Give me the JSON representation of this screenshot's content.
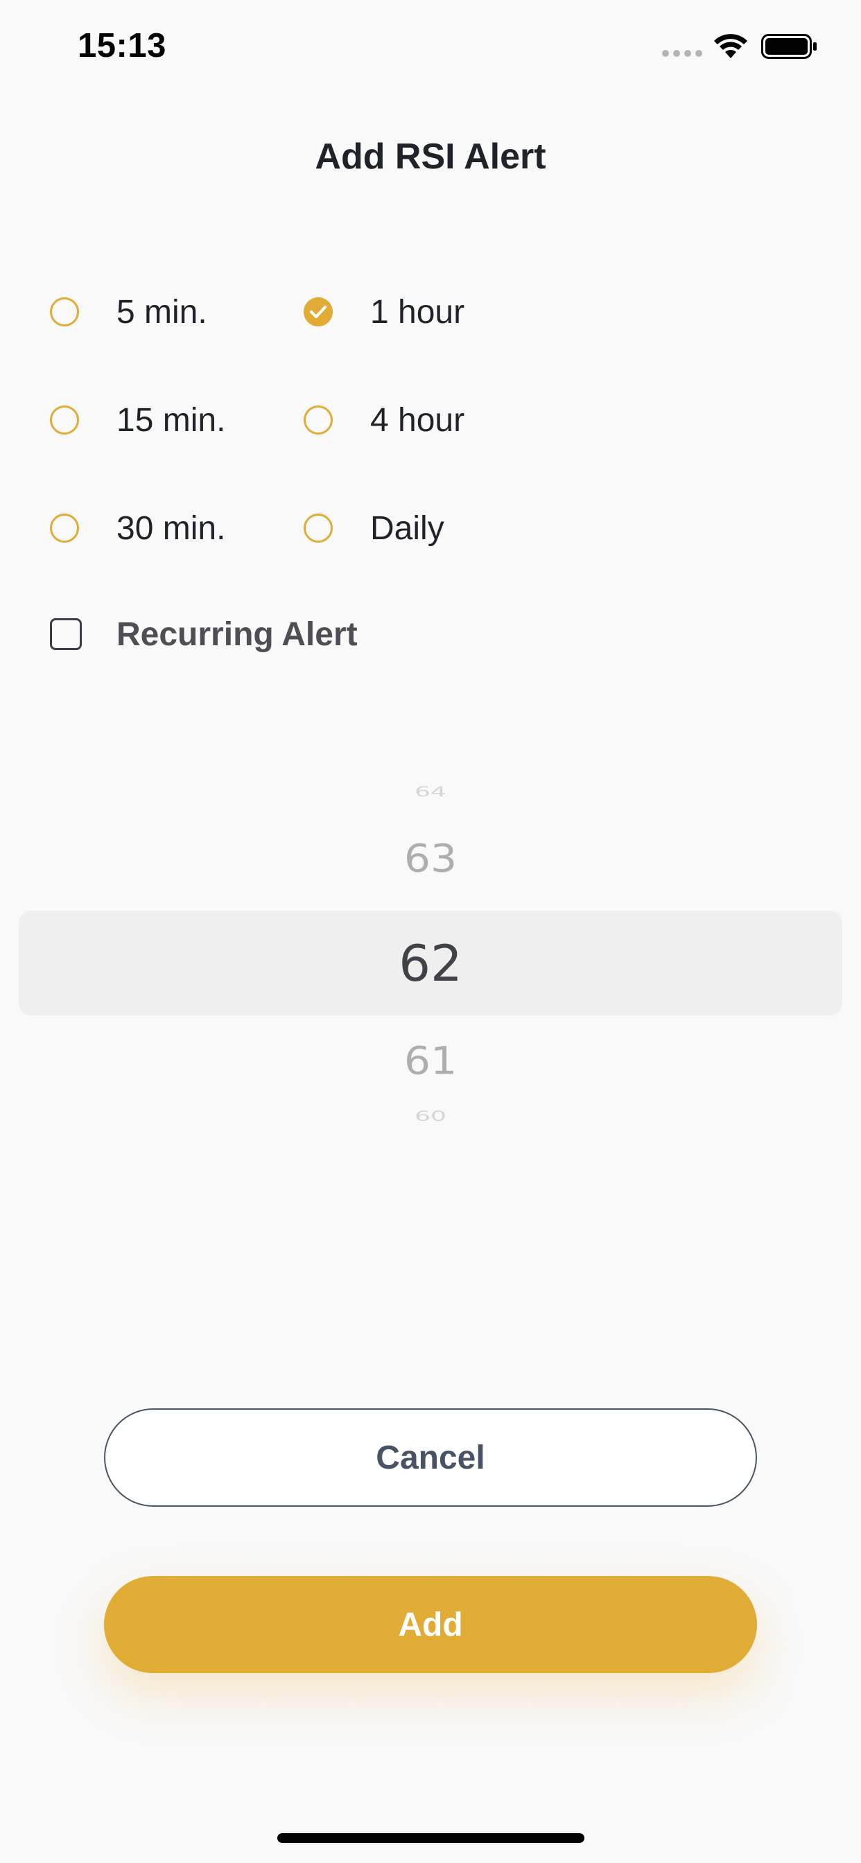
{
  "status_bar": {
    "time": "15:13",
    "icons": [
      "signal-dots-icon",
      "wifi-icon",
      "battery-icon"
    ]
  },
  "title": "Add RSI Alert",
  "colors": {
    "accent": "#e0ac36",
    "text": "#1f2329",
    "cancel_border": "#4a5563",
    "background": "#f9f9f9"
  },
  "timeframes": {
    "selected": "1 hour",
    "options": [
      {
        "label": "5 min.",
        "checked": false
      },
      {
        "label": "1 hour",
        "checked": true
      },
      {
        "label": "15 min.",
        "checked": false
      },
      {
        "label": "4 hour",
        "checked": false
      },
      {
        "label": "30 min.",
        "checked": false
      },
      {
        "label": "Daily",
        "checked": false
      }
    ]
  },
  "recurring": {
    "label": "Recurring Alert",
    "checked": false
  },
  "picker": {
    "selected": "62",
    "items": [
      "64",
      "63",
      "62",
      "61",
      "60"
    ]
  },
  "buttons": {
    "cancel": "Cancel",
    "add": "Add"
  }
}
